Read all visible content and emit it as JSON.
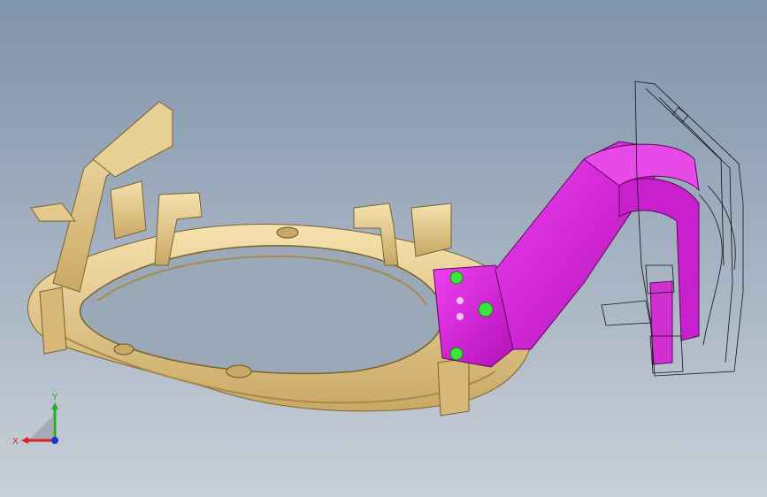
{
  "viewport": {
    "background_top": "#7f93aa",
    "background_bottom": "#c9cfd8"
  },
  "model": {
    "bracket_color": "#e4c98f",
    "bracket_shade": "#b89a5a",
    "highlight_color": "#e01ee0",
    "highlight_shade": "#a010a8",
    "weld_point_color": "#39e639",
    "wireframe_color": "#000000"
  },
  "triad": {
    "x_label": "X",
    "y_label": "Y",
    "x_color": "#e02020",
    "y_color": "#20b020",
    "z_color": "#2030e0"
  }
}
